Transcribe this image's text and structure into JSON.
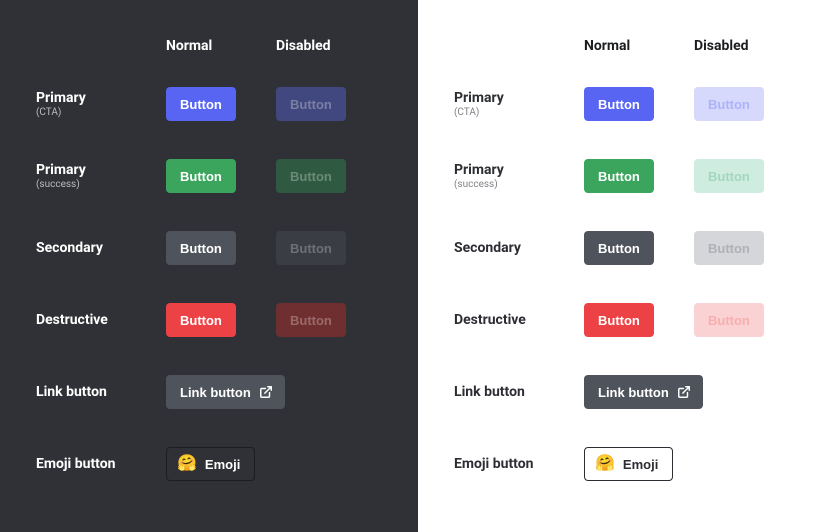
{
  "columns": {
    "normal": "Normal",
    "disabled": "Disabled"
  },
  "button_label": "Button",
  "rows": {
    "primary_cta": {
      "label": "Primary",
      "sublabel": "(CTA)"
    },
    "primary_success": {
      "label": "Primary",
      "sublabel": "(success)"
    },
    "secondary": {
      "label": "Secondary",
      "sublabel": ""
    },
    "destructive": {
      "label": "Destructive",
      "sublabel": ""
    },
    "link": {
      "label": "Link button",
      "btn_label": "Link button"
    },
    "emoji": {
      "label": "Emoji button",
      "btn_label": "Emoji",
      "emoji": "🤗"
    }
  },
  "colors": {
    "primary_cta": "#5865f2",
    "primary_success": "#3ba55d",
    "secondary": "#4f545c",
    "destructive": "#ed4245",
    "dark_bg": "#2f3136",
    "light_bg": "#ffffff"
  }
}
